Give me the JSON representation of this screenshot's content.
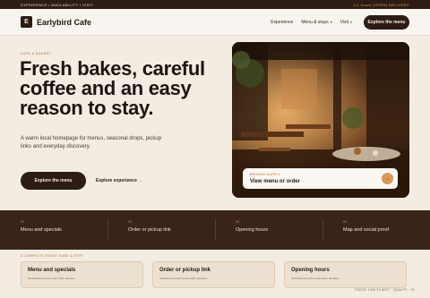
{
  "topbar": {
    "left": "EXPERIENCE / AVAILABILITY / VISIT",
    "right": "3.1 hours (OPEN) DELIVERY"
  },
  "header": {
    "logo_letter": "E",
    "brand": "Earlybird Cafe",
    "nav": [
      {
        "label": "Experience",
        "chevron": false
      },
      {
        "label": "Menu & stays",
        "chevron": true
      },
      {
        "label": "Visit",
        "chevron": true
      }
    ],
    "cta": "Explore the menu"
  },
  "hero": {
    "eyebrow": "CAFE & BAKERY",
    "headline": "Fresh bakes, careful coffee and an easy reason to stay.",
    "description": "A warm local homepage for menus, seasonal drops, pickup links and everyday discovery.",
    "primary_cta": "Explore the menu",
    "secondary_cta": "Explore experience →"
  },
  "photo_card": {
    "kicker": "BROWSE SUPPLY",
    "title": "View menu or order",
    "arrow": "→"
  },
  "band": [
    {
      "num": "01",
      "label": "Menu and specials"
    },
    {
      "num": "02",
      "label": "Order or pickup link"
    },
    {
      "num": "03",
      "label": "Opening hours"
    },
    {
      "num": "04",
      "label": "Map and social proof"
    }
  ],
  "section_label": "A COMPLETE EVENT EASE & STEP",
  "cards": [
    {
      "title": "Menu and specials",
      "sub": "Structured around a real visitor decision."
    },
    {
      "title": "Order or pickup link",
      "sub": "Structured around a real visitor decision."
    },
    {
      "title": "Opening hours",
      "sub": "Structured around a real visitor decision."
    }
  ],
  "footer_note": "FOCUS: LINE 23 NEXT · QUALITY · 24"
}
